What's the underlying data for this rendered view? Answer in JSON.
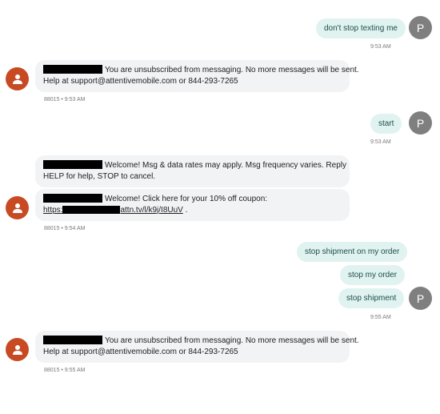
{
  "messages": {
    "out1": {
      "text": "don't stop texting me",
      "time": "9:53 AM"
    },
    "in1": {
      "line1": "You are unsubscribed from messaging. No more messages will be sent.",
      "line2": "Help at support@attentivemobile.com or 844-293-7265",
      "meta": "88015 • 9:53 AM"
    },
    "out2": {
      "text": "start",
      "time": "9:53 AM"
    },
    "in2": {
      "line1": "Welcome! Msg & data rates may apply. Msg frequency varies. Reply",
      "line2": "HELP for help, STOP to cancel."
    },
    "in3": {
      "line1": "Welcome! Click here for your 10% off coupon:",
      "link_start": "https:",
      "link_end": "attn.tv/l/k9j/I8UuV",
      "after_link": " .",
      "meta": "88015 • 9:54 AM"
    },
    "out3": {
      "text": "stop shipment on my order"
    },
    "out4": {
      "text": "stop my order"
    },
    "out5": {
      "text": "stop shipment",
      "time": "9:55 AM"
    },
    "in4": {
      "line1": "You are unsubscribed from messaging. No more messages will be sent.",
      "line2": "Help at support@attentivemobile.com or 844-293-7265",
      "meta": "88015 • 9:55 AM"
    }
  },
  "avatars": {
    "user_initial": "P",
    "sender_icon": "person-icon"
  },
  "colors": {
    "outgoing_bubble": "#e0f3f1",
    "incoming_bubble": "#f1f3f4",
    "user_avatar": "#7f7f7f",
    "sender_avatar": "#c74a23",
    "redaction": "#000000"
  }
}
